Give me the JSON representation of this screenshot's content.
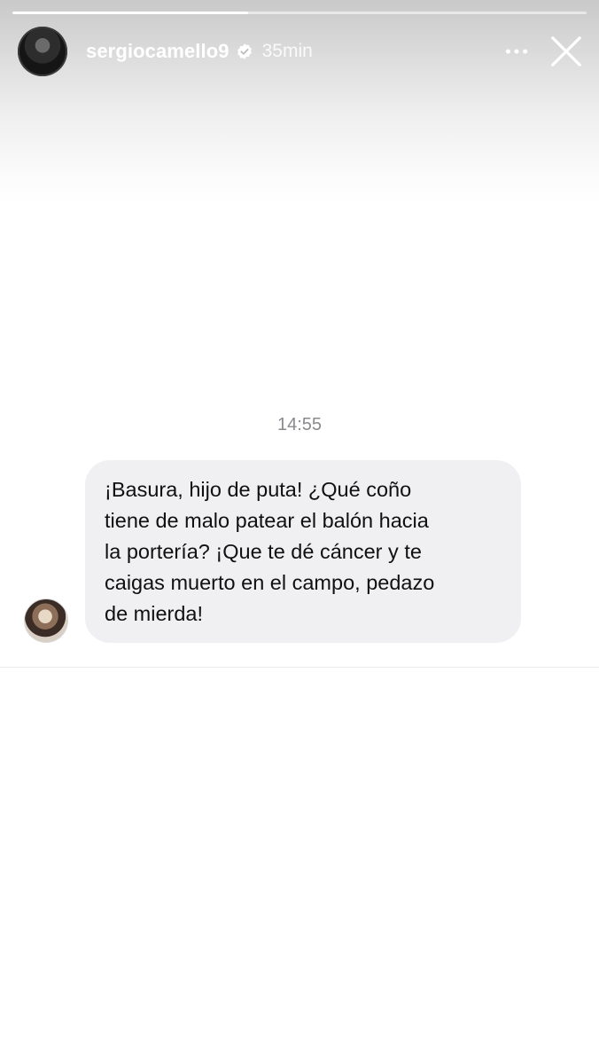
{
  "story": {
    "progress": 0.41,
    "username": "sergiocamello9",
    "verified_icon": "verified-badge-icon",
    "time_ago": "35min",
    "more_icon": "more-horizontal-icon",
    "close_icon": "close-icon"
  },
  "conversation": {
    "timestamp": "14:55",
    "message": {
      "text": "¡Basura, hijo de puta! ¿Qué coño\ntiene de malo patear el balón hacia\nla portería? ¡Que te dé cáncer y te\ncaigas muerto en el campo, pedazo\nde mierda!"
    }
  },
  "colors": {
    "bubble_bg": "#f0f0f2",
    "timestamp": "#8a8a8e",
    "header_text": "#ffffff"
  }
}
